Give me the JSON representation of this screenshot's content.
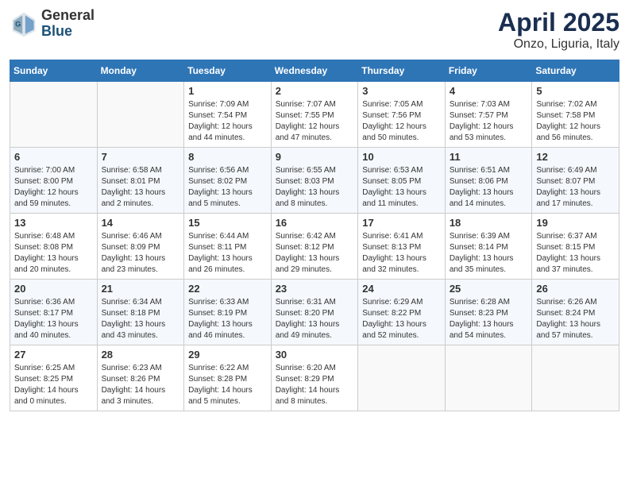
{
  "header": {
    "logo_general": "General",
    "logo_blue": "Blue",
    "month": "April 2025",
    "location": "Onzo, Liguria, Italy"
  },
  "weekdays": [
    "Sunday",
    "Monday",
    "Tuesday",
    "Wednesday",
    "Thursday",
    "Friday",
    "Saturday"
  ],
  "weeks": [
    [
      {
        "day": "",
        "info": ""
      },
      {
        "day": "",
        "info": ""
      },
      {
        "day": "1",
        "info": "Sunrise: 7:09 AM\nSunset: 7:54 PM\nDaylight: 12 hours and 44 minutes."
      },
      {
        "day": "2",
        "info": "Sunrise: 7:07 AM\nSunset: 7:55 PM\nDaylight: 12 hours and 47 minutes."
      },
      {
        "day": "3",
        "info": "Sunrise: 7:05 AM\nSunset: 7:56 PM\nDaylight: 12 hours and 50 minutes."
      },
      {
        "day": "4",
        "info": "Sunrise: 7:03 AM\nSunset: 7:57 PM\nDaylight: 12 hours and 53 minutes."
      },
      {
        "day": "5",
        "info": "Sunrise: 7:02 AM\nSunset: 7:58 PM\nDaylight: 12 hours and 56 minutes."
      }
    ],
    [
      {
        "day": "6",
        "info": "Sunrise: 7:00 AM\nSunset: 8:00 PM\nDaylight: 12 hours and 59 minutes."
      },
      {
        "day": "7",
        "info": "Sunrise: 6:58 AM\nSunset: 8:01 PM\nDaylight: 13 hours and 2 minutes."
      },
      {
        "day": "8",
        "info": "Sunrise: 6:56 AM\nSunset: 8:02 PM\nDaylight: 13 hours and 5 minutes."
      },
      {
        "day": "9",
        "info": "Sunrise: 6:55 AM\nSunset: 8:03 PM\nDaylight: 13 hours and 8 minutes."
      },
      {
        "day": "10",
        "info": "Sunrise: 6:53 AM\nSunset: 8:05 PM\nDaylight: 13 hours and 11 minutes."
      },
      {
        "day": "11",
        "info": "Sunrise: 6:51 AM\nSunset: 8:06 PM\nDaylight: 13 hours and 14 minutes."
      },
      {
        "day": "12",
        "info": "Sunrise: 6:49 AM\nSunset: 8:07 PM\nDaylight: 13 hours and 17 minutes."
      }
    ],
    [
      {
        "day": "13",
        "info": "Sunrise: 6:48 AM\nSunset: 8:08 PM\nDaylight: 13 hours and 20 minutes."
      },
      {
        "day": "14",
        "info": "Sunrise: 6:46 AM\nSunset: 8:09 PM\nDaylight: 13 hours and 23 minutes."
      },
      {
        "day": "15",
        "info": "Sunrise: 6:44 AM\nSunset: 8:11 PM\nDaylight: 13 hours and 26 minutes."
      },
      {
        "day": "16",
        "info": "Sunrise: 6:42 AM\nSunset: 8:12 PM\nDaylight: 13 hours and 29 minutes."
      },
      {
        "day": "17",
        "info": "Sunrise: 6:41 AM\nSunset: 8:13 PM\nDaylight: 13 hours and 32 minutes."
      },
      {
        "day": "18",
        "info": "Sunrise: 6:39 AM\nSunset: 8:14 PM\nDaylight: 13 hours and 35 minutes."
      },
      {
        "day": "19",
        "info": "Sunrise: 6:37 AM\nSunset: 8:15 PM\nDaylight: 13 hours and 37 minutes."
      }
    ],
    [
      {
        "day": "20",
        "info": "Sunrise: 6:36 AM\nSunset: 8:17 PM\nDaylight: 13 hours and 40 minutes."
      },
      {
        "day": "21",
        "info": "Sunrise: 6:34 AM\nSunset: 8:18 PM\nDaylight: 13 hours and 43 minutes."
      },
      {
        "day": "22",
        "info": "Sunrise: 6:33 AM\nSunset: 8:19 PM\nDaylight: 13 hours and 46 minutes."
      },
      {
        "day": "23",
        "info": "Sunrise: 6:31 AM\nSunset: 8:20 PM\nDaylight: 13 hours and 49 minutes."
      },
      {
        "day": "24",
        "info": "Sunrise: 6:29 AM\nSunset: 8:22 PM\nDaylight: 13 hours and 52 minutes."
      },
      {
        "day": "25",
        "info": "Sunrise: 6:28 AM\nSunset: 8:23 PM\nDaylight: 13 hours and 54 minutes."
      },
      {
        "day": "26",
        "info": "Sunrise: 6:26 AM\nSunset: 8:24 PM\nDaylight: 13 hours and 57 minutes."
      }
    ],
    [
      {
        "day": "27",
        "info": "Sunrise: 6:25 AM\nSunset: 8:25 PM\nDaylight: 14 hours and 0 minutes."
      },
      {
        "day": "28",
        "info": "Sunrise: 6:23 AM\nSunset: 8:26 PM\nDaylight: 14 hours and 3 minutes."
      },
      {
        "day": "29",
        "info": "Sunrise: 6:22 AM\nSunset: 8:28 PM\nDaylight: 14 hours and 5 minutes."
      },
      {
        "day": "30",
        "info": "Sunrise: 6:20 AM\nSunset: 8:29 PM\nDaylight: 14 hours and 8 minutes."
      },
      {
        "day": "",
        "info": ""
      },
      {
        "day": "",
        "info": ""
      },
      {
        "day": "",
        "info": ""
      }
    ]
  ]
}
